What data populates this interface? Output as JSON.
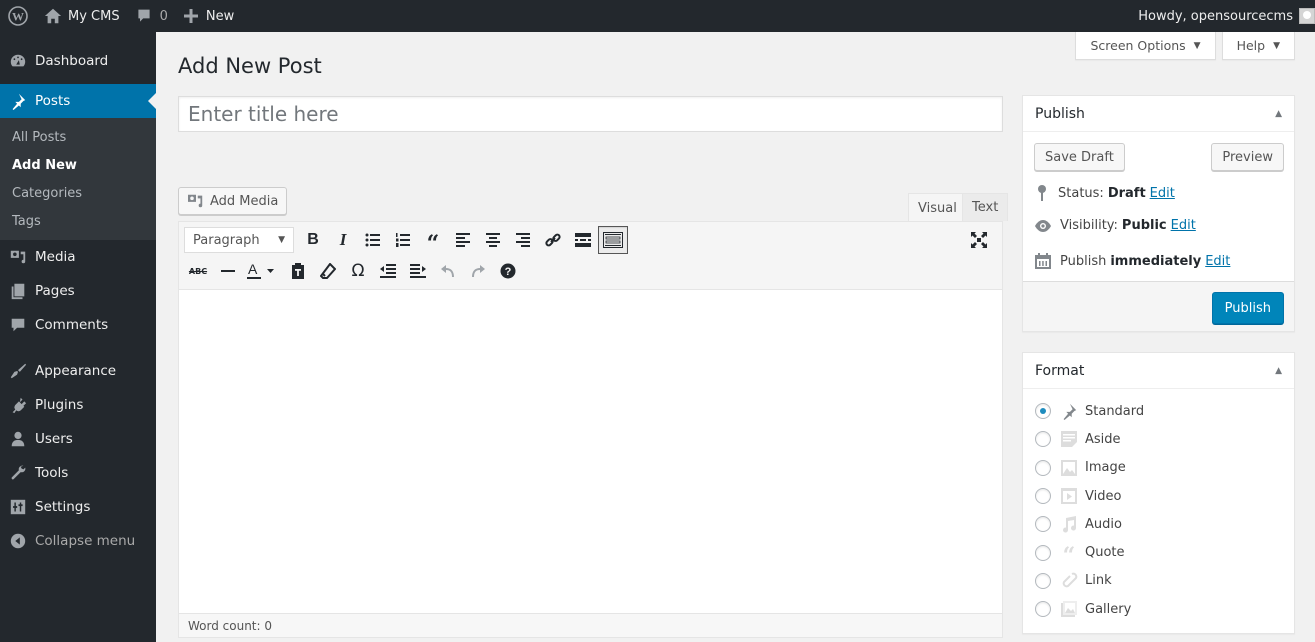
{
  "adminbar": {
    "site_name": "My CMS",
    "comments_count": "0",
    "new_label": "New",
    "greeting": "Howdy, opensourcecms"
  },
  "sidebar": {
    "items": [
      {
        "label": "Dashboard",
        "icon": "dashboard-icon"
      },
      {
        "label": "Posts",
        "icon": "pin-icon",
        "current": true
      },
      {
        "label": "Media",
        "icon": "media-icon"
      },
      {
        "label": "Pages",
        "icon": "pages-icon"
      },
      {
        "label": "Comments",
        "icon": "comment-icon"
      },
      {
        "label": "Appearance",
        "icon": "paintbrush-icon"
      },
      {
        "label": "Plugins",
        "icon": "plug-icon"
      },
      {
        "label": "Users",
        "icon": "user-icon"
      },
      {
        "label": "Tools",
        "icon": "wrench-icon"
      },
      {
        "label": "Settings",
        "icon": "sliders-icon"
      },
      {
        "label": "Collapse menu",
        "icon": "collapse-icon"
      }
    ],
    "posts_submenu": [
      {
        "label": "All Posts"
      },
      {
        "label": "Add New",
        "current": true
      },
      {
        "label": "Categories"
      },
      {
        "label": "Tags"
      }
    ]
  },
  "screen_meta": {
    "screen_options": "Screen Options",
    "help": "Help"
  },
  "main": {
    "page_title": "Add New Post",
    "title_placeholder": "Enter title here",
    "add_media": "Add Media",
    "tabs": {
      "visual": "Visual",
      "text": "Text"
    },
    "format_select": "Paragraph",
    "word_count": "Word count: 0"
  },
  "publish": {
    "title": "Publish",
    "save_draft": "Save Draft",
    "preview": "Preview",
    "status_label": "Status:",
    "status_value": "Draft",
    "visibility_label": "Visibility:",
    "visibility_value": "Public",
    "schedule_label": "Publish",
    "schedule_value": "immediately",
    "edit": "Edit",
    "publish_button": "Publish"
  },
  "format": {
    "title": "Format",
    "selected": "Standard",
    "options": [
      "Standard",
      "Aside",
      "Image",
      "Video",
      "Audio",
      "Quote",
      "Link",
      "Gallery"
    ]
  },
  "colors": {
    "accent": "#0073aa",
    "publish_button": "#0085ba",
    "adminbar_bg": "#23282d"
  }
}
